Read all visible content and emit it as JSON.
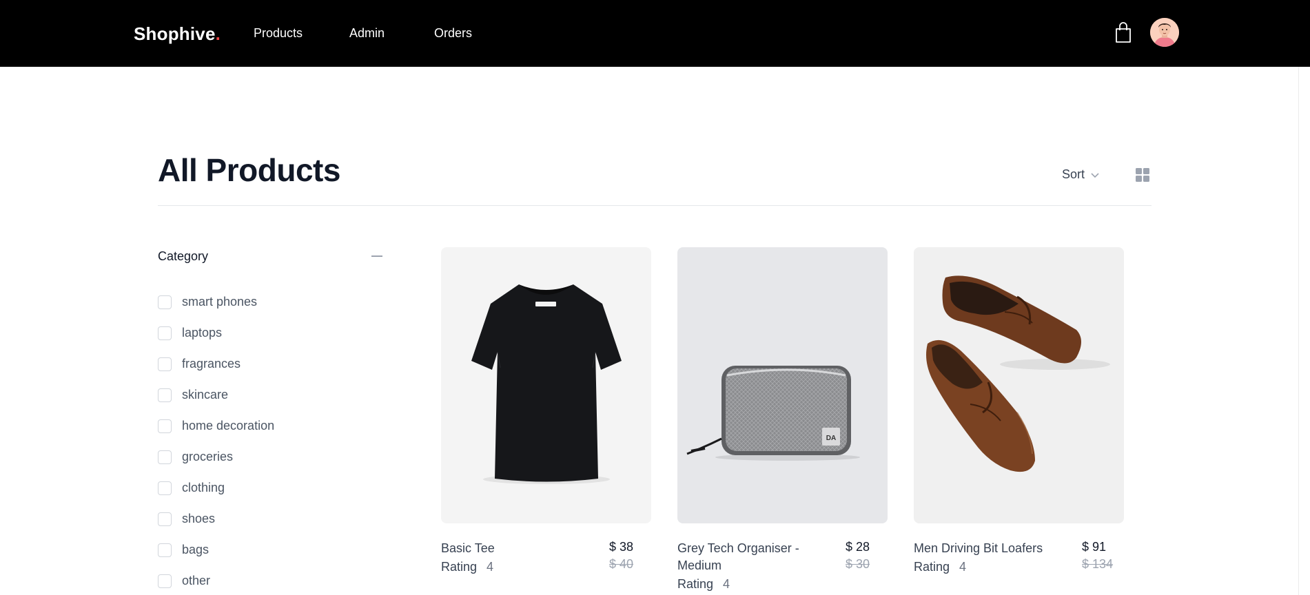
{
  "header": {
    "brand": "Shophive",
    "brand_dot": ".",
    "nav": [
      "Products",
      "Admin",
      "Orders"
    ],
    "cart_icon": "shopping-bag-icon",
    "avatar": "user-avatar"
  },
  "main": {
    "title": "All Products",
    "sort_label": "Sort",
    "view_icon": "grid-view-icon"
  },
  "filters": {
    "title": "Category",
    "toggle_icon": "minus-icon",
    "options": [
      "smart phones",
      "laptops",
      "fragrances",
      "skincare",
      "home decoration",
      "groceries",
      "clothing",
      "shoes",
      "bags",
      "other"
    ]
  },
  "products": [
    {
      "name": "Basic Tee",
      "price": "$ 38",
      "old_price": "$ 40",
      "rating_label": "Rating",
      "rating": "4",
      "bg": "#f4f4f4"
    },
    {
      "name": "Grey Tech Organiser - Medium",
      "price": "$ 28",
      "old_price": "$ 30",
      "rating_label": "Rating",
      "rating": "4",
      "bg": "#e6e7ea"
    },
    {
      "name": "Men Driving Bit Loafers",
      "price": "$ 91",
      "old_price": "$ 134",
      "rating_label": "Rating",
      "rating": "4",
      "bg": "#f0f0f0"
    }
  ],
  "colors": {
    "header_bg": "#000000",
    "brand_dot": "#ef4444",
    "title": "#111827",
    "muted": "#9ca3af"
  }
}
